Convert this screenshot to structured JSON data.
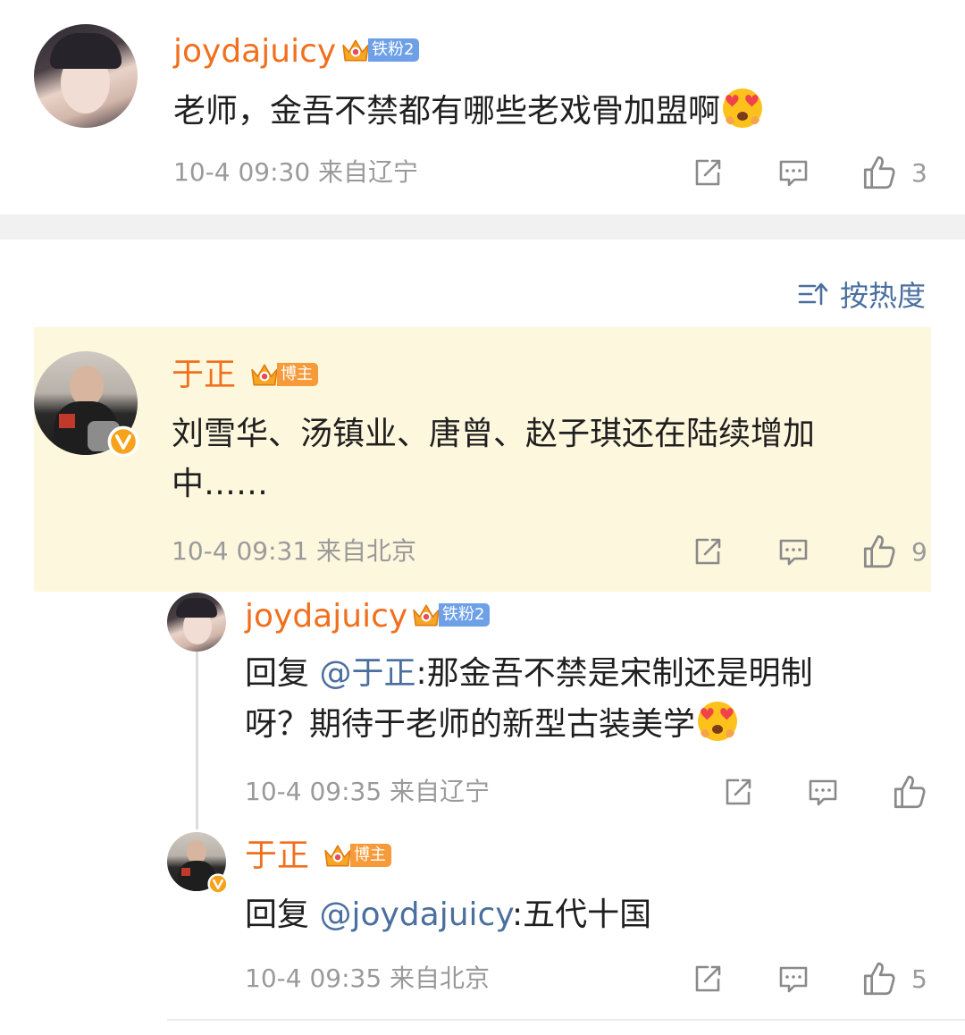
{
  "comment1": {
    "username": "joydajuicy",
    "badge_level": "4",
    "badge_label": "铁粉2",
    "text": "老师，金吾不禁都有哪些老戏骨加盟啊",
    "time": "10-4 09:30",
    "location": "来自辽宁",
    "likes": "3"
  },
  "sort": {
    "label": "按热度"
  },
  "comment2": {
    "username": "于正",
    "badge_level": "7",
    "badge_label": "博主",
    "text_line1": "刘雪华、汤镇业、唐曾、赵子琪还在陆续增加",
    "text_line2": "中……",
    "time": "10-4 09:31",
    "location": "来自北京",
    "likes": "9"
  },
  "reply1": {
    "username": "joydajuicy",
    "badge_level": "4",
    "badge_label": "铁粉2",
    "reply_prefix": "回复",
    "mention": "@于正",
    "text_line1": ":那金吾不禁是宋制还是明制",
    "text_line2": "呀？期待于老师的新型古装美学",
    "time": "10-4 09:35",
    "location": "来自辽宁"
  },
  "reply2": {
    "username": "于正",
    "badge_level": "7",
    "badge_label": "博主",
    "reply_prefix": "回复",
    "mention": "@joydajuicy",
    "text": ":五代十国",
    "time": "10-4 09:35",
    "location": "来自北京",
    "likes": "5"
  },
  "colors": {
    "accent": "#f0701e",
    "highlight": "#fdf7dd",
    "mention": "#4b6f9e",
    "fan_badge": "#6ea0e8",
    "host_badge": "#f79a3a"
  },
  "icons": [
    "share-icon",
    "comment-icon",
    "like-icon",
    "sort-icon",
    "verified-icon",
    "crown-icon",
    "heart-eyes-emoji"
  ]
}
